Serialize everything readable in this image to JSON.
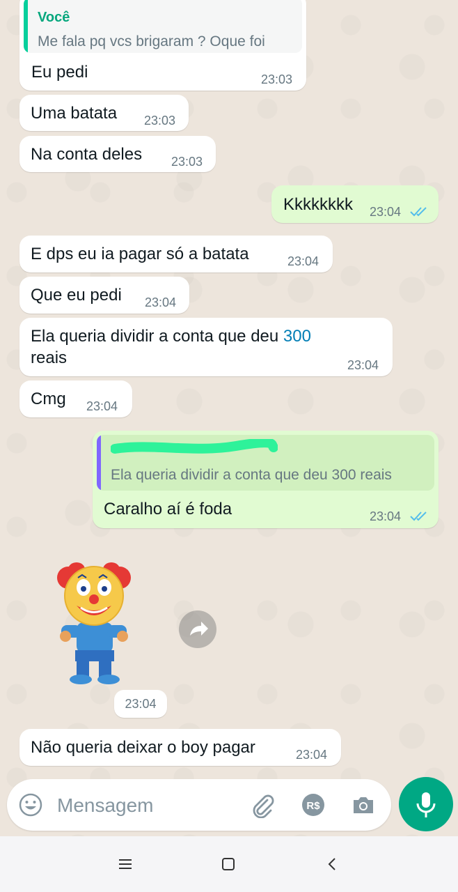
{
  "messages": {
    "m1": {
      "quote_name": "Você",
      "quote_text": "Me fala pq vcs brigaram ? Oque foi",
      "text": "Eu pedi",
      "time": "23:03"
    },
    "m2": {
      "text": "Uma batata",
      "time": "23:03"
    },
    "m3": {
      "text": "Na conta deles",
      "time": "23:03"
    },
    "m4": {
      "text": "Kkkkkkkk",
      "time": "23:04"
    },
    "m5": {
      "text": "E dps eu ia pagar só a batata",
      "time": "23:04"
    },
    "m6": {
      "text": "Que eu pedi",
      "time": "23:04"
    },
    "m7": {
      "text_a": "Ela queria dividir a conta que deu ",
      "text_link": "300",
      "text_b": "reais",
      "time": "23:04"
    },
    "m8": {
      "text": "Cmg",
      "time": "23:04"
    },
    "m9": {
      "quote_text": "Ela queria dividir a conta que deu 300 reais",
      "text": "Caralho aí é foda",
      "time": "23:04"
    },
    "sticker": {
      "time": "23:04",
      "icon": "clown-sticker"
    },
    "m10": {
      "text": "Não queria deixar o boy pagar",
      "time": "23:04"
    }
  },
  "composer": {
    "placeholder": "Mensagem"
  },
  "colors": {
    "accent": "#00a884",
    "read_ticks": "#53bdeb",
    "link": "#027eb5",
    "quote_you": "#06cf9c",
    "quote_other": "#7f66ff"
  }
}
